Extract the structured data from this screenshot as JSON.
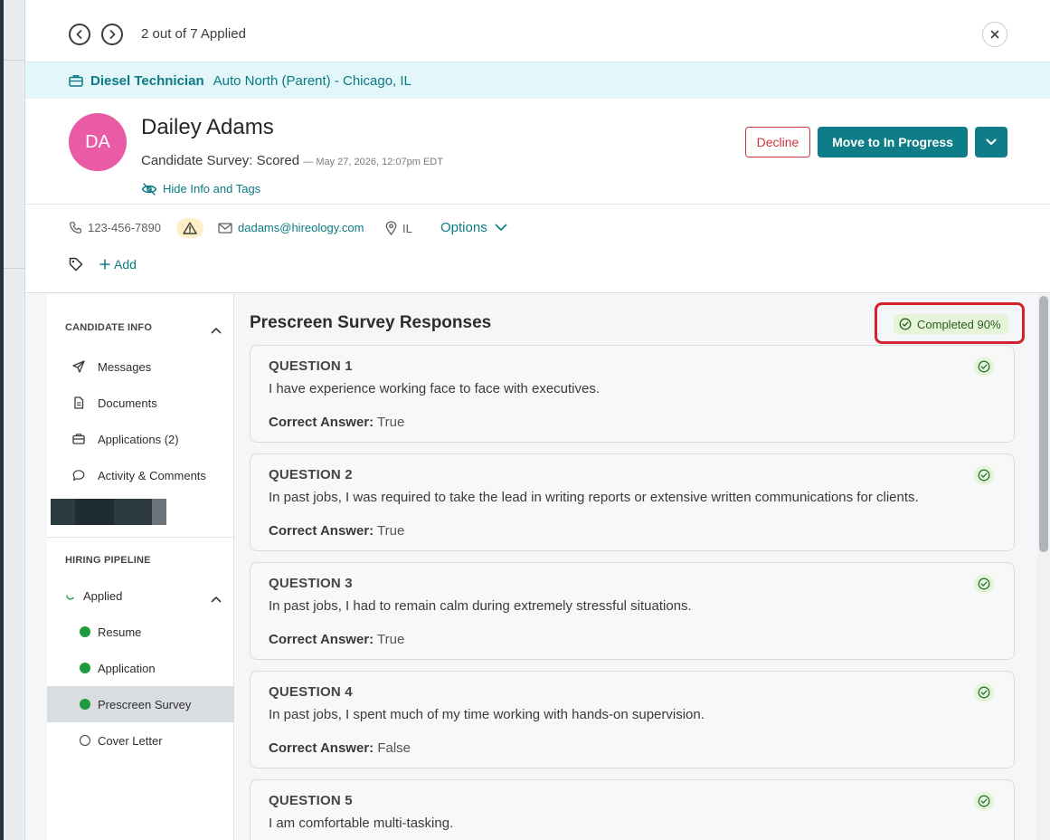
{
  "nav": {
    "count_text": "2 out of 7 Applied"
  },
  "job": {
    "title": "Diesel Technician",
    "location": "Auto North (Parent) - Chicago, IL"
  },
  "candidate": {
    "initials": "DA",
    "name": "Dailey Adams",
    "status": "Candidate Survey: Scored",
    "timestamp": "— May 27, 2026, 12:07pm EDT",
    "hide_info_label": "Hide Info and Tags",
    "avatar_color": "#ea5ba5"
  },
  "actions": {
    "decline_label": "Decline",
    "move_label": "Move to In Progress"
  },
  "contact": {
    "phone": "123-456-7890",
    "email": "dadams@hireology.com",
    "location": "IL",
    "options_label": "Options",
    "add_tag_label": "Add"
  },
  "sidebar": {
    "candidate_info_heading": "CANDIDATE INFO",
    "items": [
      {
        "label": "Messages",
        "icon": "send-icon"
      },
      {
        "label": "Documents",
        "icon": "document-icon"
      },
      {
        "label": "Applications (2)",
        "icon": "briefcase-icon"
      },
      {
        "label": "Activity & Comments",
        "icon": "comment-icon"
      }
    ],
    "pipeline_heading": "HIRING PIPELINE",
    "pipeline_stage": "Applied",
    "steps": [
      {
        "label": "Resume",
        "done": true
      },
      {
        "label": "Application",
        "done": true
      },
      {
        "label": "Prescreen Survey",
        "done": true,
        "active": true
      },
      {
        "label": "Cover Letter",
        "done": false
      }
    ]
  },
  "survey": {
    "title": "Prescreen Survey Responses",
    "completion_label": "Completed 90%",
    "answer_prefix": "Correct Answer:",
    "questions": [
      {
        "label": "QUESTION 1",
        "text": "I have experience working face to face with executives.",
        "answer": "True"
      },
      {
        "label": "QUESTION 2",
        "text": "In past jobs, I was required to take the lead in writing reports or extensive written communications for clients.",
        "answer": "True"
      },
      {
        "label": "QUESTION 3",
        "text": "In past jobs, I had to remain calm during extremely stressful situations.",
        "answer": "True"
      },
      {
        "label": "QUESTION 4",
        "text": "In past jobs, I spent much of my time working with hands-on supervision.",
        "answer": "False"
      },
      {
        "label": "QUESTION 5",
        "text": "I am comfortable multi-tasking.",
        "answer": ""
      }
    ]
  },
  "colors": {
    "brand": "#0f7d87",
    "danger": "#c8373c",
    "success": "#1e9a3c",
    "highlight": "#d3212d"
  }
}
